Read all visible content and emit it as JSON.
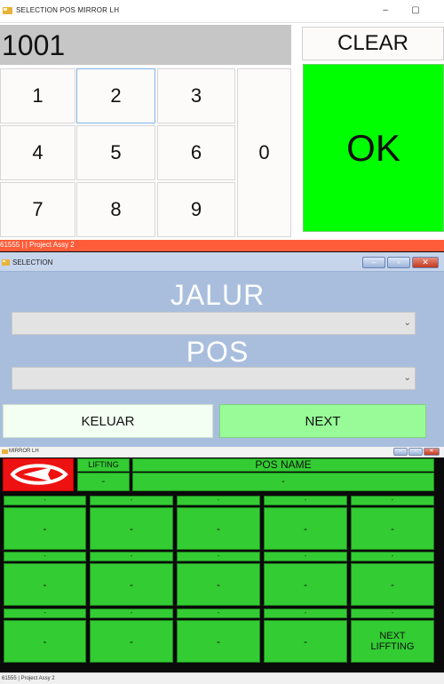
{
  "keypad_window": {
    "title": "SELECTION POS MIRROR LH",
    "display_value": "1001",
    "keys": [
      "1",
      "2",
      "3",
      "4",
      "5",
      "6",
      "7",
      "8",
      "9",
      "0"
    ],
    "clear_label": "CLEAR",
    "ok_label": "OK",
    "ok_color": "#00ff00",
    "status_text": "61555 | | Project Assy 2",
    "status_color": "#ff5c3a"
  },
  "selection_window": {
    "title": "SELECTION",
    "jalur_label": "JALUR",
    "jalur_value": "",
    "pos_label": "POS",
    "pos_value": "",
    "keluar_label": "KELUAR",
    "next_label": "NEXT",
    "next_color": "#98fb98",
    "background_color": "#a9bedd"
  },
  "mirror_window": {
    "title": "MIRROR LH",
    "logo_icon": "daihatsu-logo-icon",
    "lifting_label": "LIFTING",
    "lifting_value": "-",
    "pos_name_label": "POS NAME",
    "pos_name_value": "-",
    "cell_color": "#33cc33",
    "rows": [
      {
        "labels": [
          "-",
          "-",
          "-",
          "-",
          "-"
        ],
        "values": [
          "-",
          "-",
          "-",
          "-",
          "-"
        ]
      },
      {
        "labels": [
          "-",
          "-",
          "-",
          "-",
          "-"
        ],
        "values": [
          "-",
          "-",
          "-",
          "-",
          "-"
        ]
      },
      {
        "labels": [
          "-",
          "-",
          "-",
          "-",
          "-"
        ],
        "values": [
          "-",
          "-",
          "-",
          "-",
          "NEXT\nLIFFTING"
        ]
      }
    ],
    "status_text": "61555 | Project Assy 2"
  }
}
